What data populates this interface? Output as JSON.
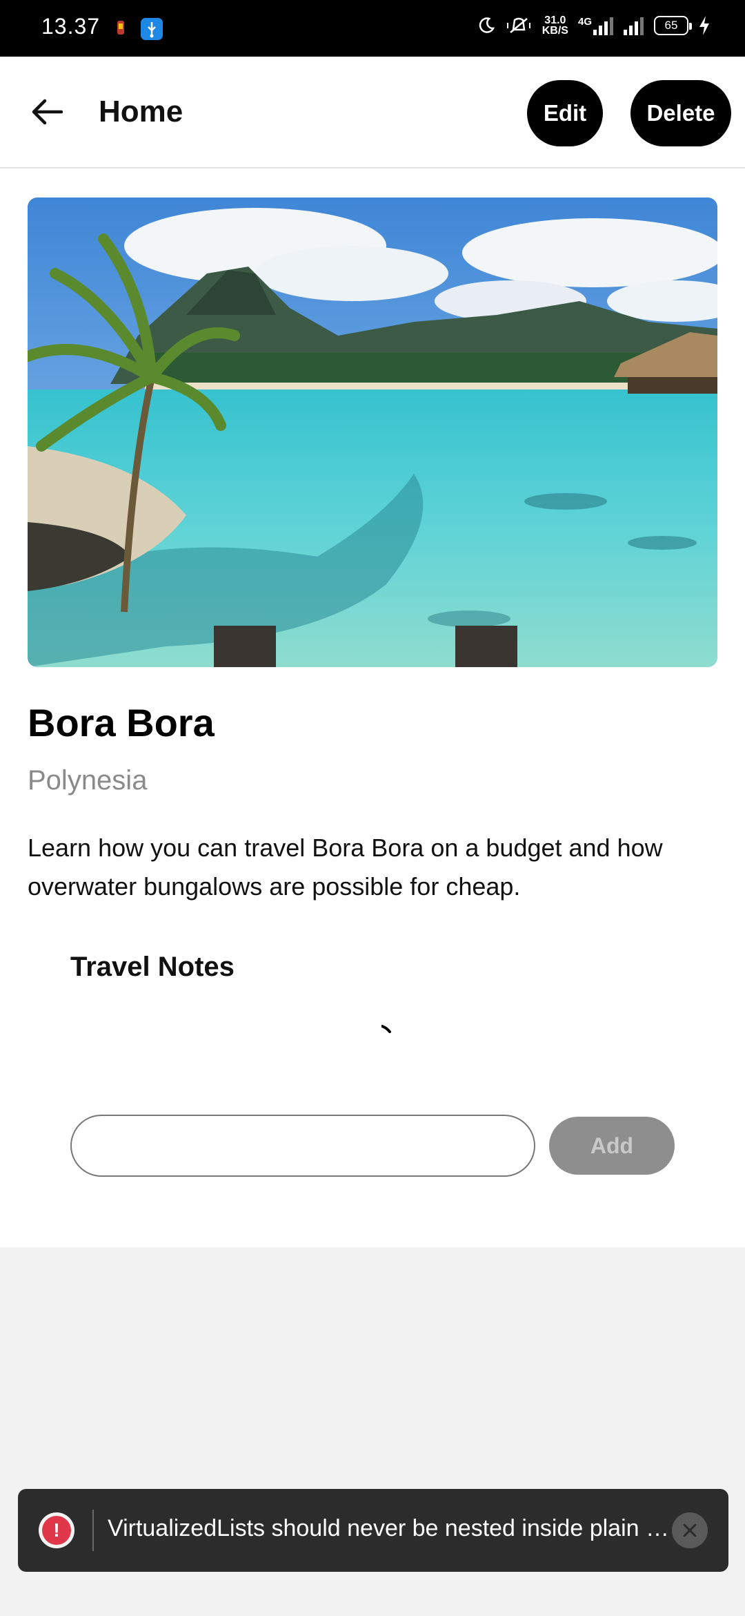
{
  "status_bar": {
    "time": "13.37",
    "net_speed_value": "31.0",
    "net_speed_unit": "KB/S",
    "network_type": "4G",
    "battery": "65"
  },
  "header": {
    "title": "Home",
    "edit_label": "Edit",
    "delete_label": "Delete"
  },
  "place": {
    "title": "Bora Bora",
    "subtitle": "Polynesia",
    "description": "Learn how you can travel Bora Bora on a budget and how overwater bungalows are possible for cheap."
  },
  "notes": {
    "title": "Travel Notes",
    "input_value": "",
    "input_placeholder": "",
    "add_label": "Add"
  },
  "toast": {
    "message": "VirtualizedLists should never be nested inside plain S..."
  },
  "colors": {
    "accent": "#000000",
    "error": "#e0384a",
    "disabled_button": "#8e8e8e"
  },
  "icons": {
    "back": "arrow-left-icon",
    "error": "exclamation-icon",
    "close": "close-icon"
  }
}
